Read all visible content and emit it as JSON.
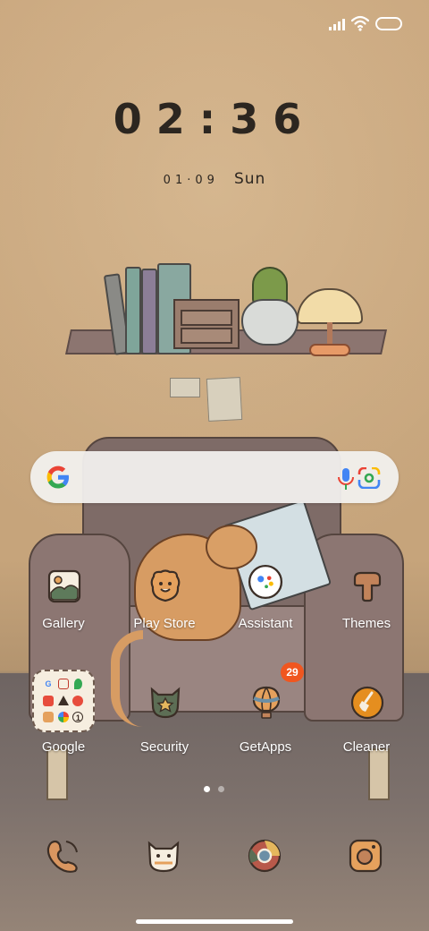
{
  "status_bar": {
    "signal_icon": "signal-bars",
    "wifi_icon": "wifi",
    "battery_icon": "battery"
  },
  "clock": {
    "time": "02:36",
    "date": "01·09",
    "weekday": "Sun"
  },
  "search": {
    "google_icon": "google-g",
    "mic_icon": "microphone",
    "lens_icon": "google-lens"
  },
  "apps_row1": [
    {
      "label": "Gallery",
      "icon": "gallery-icon"
    },
    {
      "label": "Play Store",
      "icon": "play-store-icon"
    },
    {
      "label": "Assistant",
      "icon": "assistant-icon"
    },
    {
      "label": "Themes",
      "icon": "themes-icon"
    }
  ],
  "apps_row2": [
    {
      "label": "Google",
      "icon": "google-folder"
    },
    {
      "label": "Security",
      "icon": "security-icon"
    },
    {
      "label": "GetApps",
      "icon": "getapps-icon",
      "badge": "29"
    },
    {
      "label": "Cleaner",
      "icon": "cleaner-icon"
    }
  ],
  "pager": {
    "pages": 2,
    "current": 1
  },
  "dock": [
    {
      "icon": "phone-icon"
    },
    {
      "icon": "messages-icon"
    },
    {
      "icon": "chrome-icon"
    },
    {
      "icon": "camera-icon"
    }
  ],
  "colors": {
    "clock_text": "#2c2620",
    "badge": "#f0561f",
    "icon_orange": "#e5a15d",
    "icon_cream": "#f6eee0",
    "icon_outline": "#3b2e26"
  }
}
